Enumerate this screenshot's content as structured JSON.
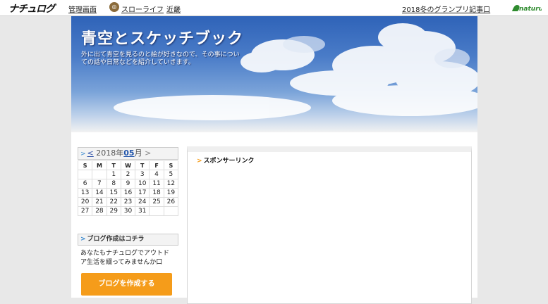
{
  "topbar": {
    "logo": "ナチュログ",
    "admin_link": "管理画面",
    "category_icon_name": "category-icon",
    "category_link": "スローライフ",
    "region_link": "近畿",
    "article_link": "2018冬のグランプリ記事口",
    "brand_text": "naturum"
  },
  "header": {
    "title": "青空とスケッチブック",
    "description": "外に出て青空を見るのと絵が好きなので、その事についての話や日常などを紹介していきます。"
  },
  "calendar": {
    "prev": "<",
    "year": "2018年",
    "month": "05",
    "month_suffix": "月",
    "next": ">",
    "weekdays": [
      "S",
      "M",
      "T",
      "W",
      "T",
      "F",
      "S"
    ],
    "weeks": [
      [
        "",
        "",
        "1",
        "2",
        "3",
        "4",
        "5"
      ],
      [
        "6",
        "7",
        "8",
        "9",
        "10",
        "11",
        "12"
      ],
      [
        "13",
        "14",
        "15",
        "16",
        "17",
        "18",
        "19"
      ],
      [
        "20",
        "21",
        "22",
        "23",
        "24",
        "25",
        "26"
      ],
      [
        "27",
        "28",
        "29",
        "30",
        "31",
        "",
        ""
      ]
    ]
  },
  "blog_box": {
    "heading": "ブログ作成はコチラ",
    "text": "あなたもナチュログでアウトドア生活を綴ってみませんか口",
    "button": "ブログを作成する"
  },
  "main": {
    "sponsor_heading": "スポンサーリンク"
  },
  "colors": {
    "accent": "#f59c1a",
    "link": "#2255aa",
    "sky": "#4a7cc8"
  }
}
